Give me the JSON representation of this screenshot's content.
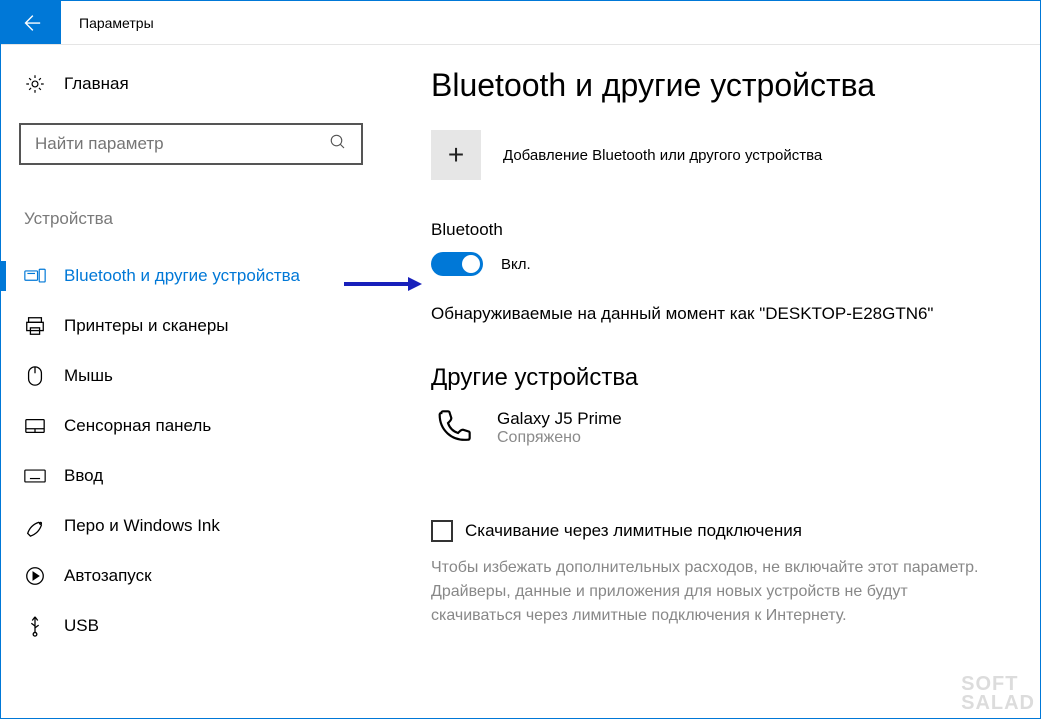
{
  "titlebar": {
    "title": "Параметры"
  },
  "sidebar": {
    "home": "Главная",
    "search_placeholder": "Найти параметр",
    "section": "Устройства",
    "items": [
      {
        "label": "Bluetooth и другие устройства"
      },
      {
        "label": "Принтеры и сканеры"
      },
      {
        "label": "Мышь"
      },
      {
        "label": "Сенсорная панель"
      },
      {
        "label": "Ввод"
      },
      {
        "label": "Перо и Windows Ink"
      },
      {
        "label": "Автозапуск"
      },
      {
        "label": "USB"
      }
    ]
  },
  "main": {
    "title": "Bluetooth и другие устройства",
    "add_label": "Добавление Bluetooth или другого устройства",
    "bt_label": "Bluetooth",
    "toggle_state": "Вкл.",
    "discoverable": "Обнаруживаемые на данный момент как \"DESKTOP-E28GTN6\"",
    "other_devices": "Другие устройства",
    "device": {
      "name": "Galaxy J5 Prime",
      "status": "Сопряжено"
    },
    "metered_label": "Скачивание через лимитные подключения",
    "metered_info": "Чтобы избежать дополнительных расходов, не включайте этот параметр. Драйверы, данные и приложения для новых устройств не будут скачиваться через лимитные подключения к Интернету."
  },
  "watermark": {
    "line1": "SOFT",
    "line2": "SALAD"
  }
}
